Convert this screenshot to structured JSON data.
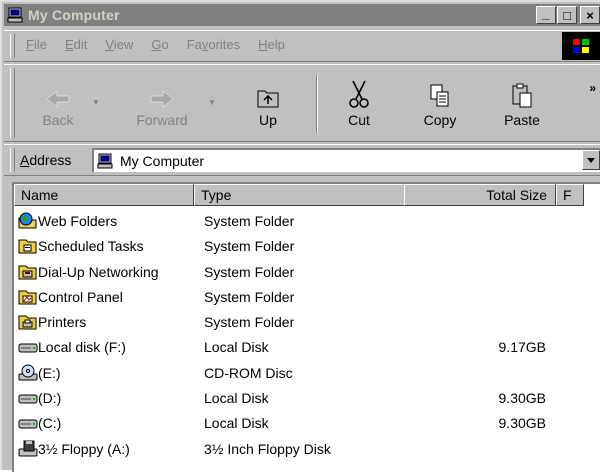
{
  "window": {
    "title": "My Computer",
    "minimize": "_",
    "maximize": "□",
    "close": "×"
  },
  "menu": {
    "items": [
      {
        "ul": "F",
        "rest": "ile"
      },
      {
        "ul": "E",
        "rest": "dit"
      },
      {
        "ul": "V",
        "rest": "iew"
      },
      {
        "ul": "G",
        "rest": "o"
      },
      {
        "ul": "",
        "rest": "Favorites",
        "ul_index": 2
      },
      {
        "ul": "H",
        "rest": "elp"
      }
    ]
  },
  "toolbar": {
    "back": "Back",
    "forward": "Forward",
    "up": "Up",
    "cut": "Cut",
    "copy": "Copy",
    "paste": "Paste",
    "more": "»"
  },
  "address": {
    "label_ul": "A",
    "label_rest": "ddress",
    "value": "My Computer"
  },
  "columns": {
    "name": "Name",
    "type": "Type",
    "total_size": "Total Size",
    "free": "F"
  },
  "rows": [
    {
      "name": "Web Folders",
      "type": "System Folder",
      "size": "",
      "icon": "web-folders-icon"
    },
    {
      "name": "Scheduled Tasks",
      "type": "System Folder",
      "size": "",
      "icon": "scheduled-tasks-icon"
    },
    {
      "name": "Dial-Up Networking",
      "type": "System Folder",
      "size": "",
      "icon": "dialup-networking-icon"
    },
    {
      "name": "Control Panel",
      "type": "System Folder",
      "size": "",
      "icon": "control-panel-icon"
    },
    {
      "name": "Printers",
      "type": "System Folder",
      "size": "",
      "icon": "printers-icon"
    },
    {
      "name": "Local disk (F:)",
      "type": "Local Disk",
      "size": "9.17GB",
      "icon": "hard-disk-icon"
    },
    {
      "name": "(E:)",
      "type": "CD-ROM Disc",
      "size": "",
      "icon": "cd-rom-icon"
    },
    {
      "name": "(D:)",
      "type": "Local Disk",
      "size": "9.30GB",
      "icon": "hard-disk-icon"
    },
    {
      "name": "(C:)",
      "type": "Local Disk",
      "size": "9.30GB",
      "icon": "hard-disk-icon"
    },
    {
      "name": "3½ Floppy (A:)",
      "type": "3½ Inch Floppy Disk",
      "size": "",
      "icon": "floppy-disk-icon"
    }
  ]
}
